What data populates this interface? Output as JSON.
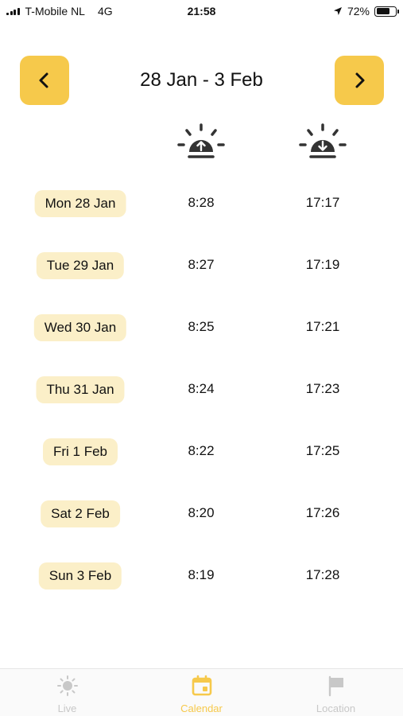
{
  "status_bar": {
    "carrier": "T-Mobile NL",
    "network": "4G",
    "time": "21:58",
    "battery_percent": "72%",
    "battery_level": 0.72
  },
  "header": {
    "title": "28 Jan - 3 Feb",
    "prev_icon": "chevron-left-icon",
    "next_icon": "chevron-right-icon"
  },
  "columns": {
    "sunrise_icon": "sunrise-icon",
    "sunset_icon": "sunset-icon"
  },
  "days": [
    {
      "label": "Mon 28 Jan",
      "sunrise": "8:28",
      "sunset": "17:17"
    },
    {
      "label": "Tue 29 Jan",
      "sunrise": "8:27",
      "sunset": "17:19"
    },
    {
      "label": "Wed 30 Jan",
      "sunrise": "8:25",
      "sunset": "17:21"
    },
    {
      "label": "Thu 31 Jan",
      "sunrise": "8:24",
      "sunset": "17:23"
    },
    {
      "label": "Fri 1 Feb",
      "sunrise": "8:22",
      "sunset": "17:25"
    },
    {
      "label": "Sat 2 Feb",
      "sunrise": "8:20",
      "sunset": "17:26"
    },
    {
      "label": "Sun 3 Feb",
      "sunrise": "8:19",
      "sunset": "17:28"
    }
  ],
  "tab_bar": {
    "active": "Calendar",
    "tabs": [
      {
        "label": "Live",
        "icon": "sun-icon"
      },
      {
        "label": "Calendar",
        "icon": "calendar-icon"
      },
      {
        "label": "Location",
        "icon": "flag-icon"
      }
    ]
  },
  "colors": {
    "accent": "#f6c94b",
    "pill_background": "#fbefc8",
    "inactive_tab": "#c8c8c8"
  }
}
